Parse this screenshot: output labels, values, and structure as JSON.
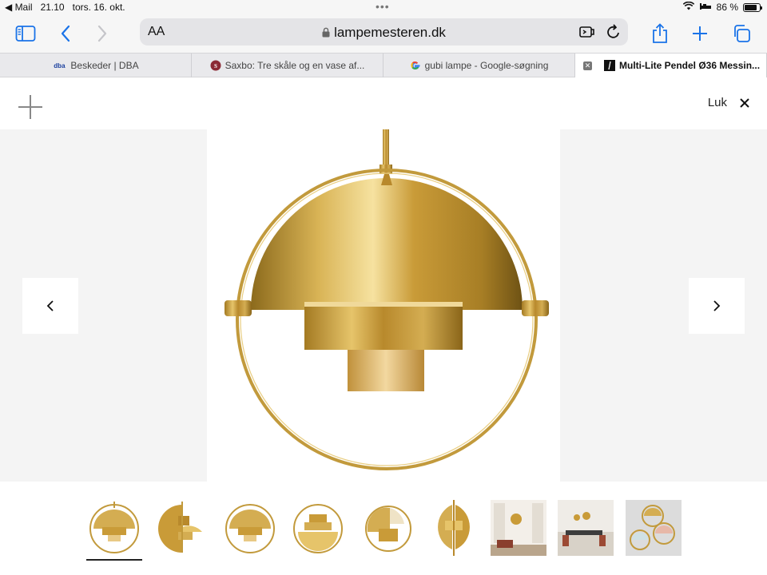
{
  "status_bar": {
    "back_app": "◀ Mail",
    "time": "21.10",
    "date": "tors. 16. okt.",
    "battery": "86 %",
    "battery_level": 0.86
  },
  "toolbar": {
    "reader_label": "AA",
    "url": "lampemesteren.dk"
  },
  "tabs": [
    {
      "favicon": "dba",
      "label": "Beskeder | DBA"
    },
    {
      "favicon": "saxbo-logo",
      "label": "Saxbo: Tre skåle og en vase af..."
    },
    {
      "favicon": "google-g",
      "label": "gubi lampe - Google-søgning"
    },
    {
      "favicon": "lampemesteren-logo",
      "label": "Multi-Lite Pendel Ø36 Messin..."
    }
  ],
  "viewer": {
    "close_label": "Luk",
    "selected_thumbnail": 0,
    "thumbnails": [
      {
        "name": "front-view"
      },
      {
        "name": "side-open-view"
      },
      {
        "name": "front-view-2"
      },
      {
        "name": "top-open-view"
      },
      {
        "name": "angled-view"
      },
      {
        "name": "split-view"
      },
      {
        "name": "living-room-photo"
      },
      {
        "name": "dining-room-photo"
      },
      {
        "name": "color-variants-photo"
      }
    ]
  },
  "colors": {
    "accent": "#1a73e8",
    "brass": "#c9a23a",
    "panel": "#f4f4f4"
  }
}
